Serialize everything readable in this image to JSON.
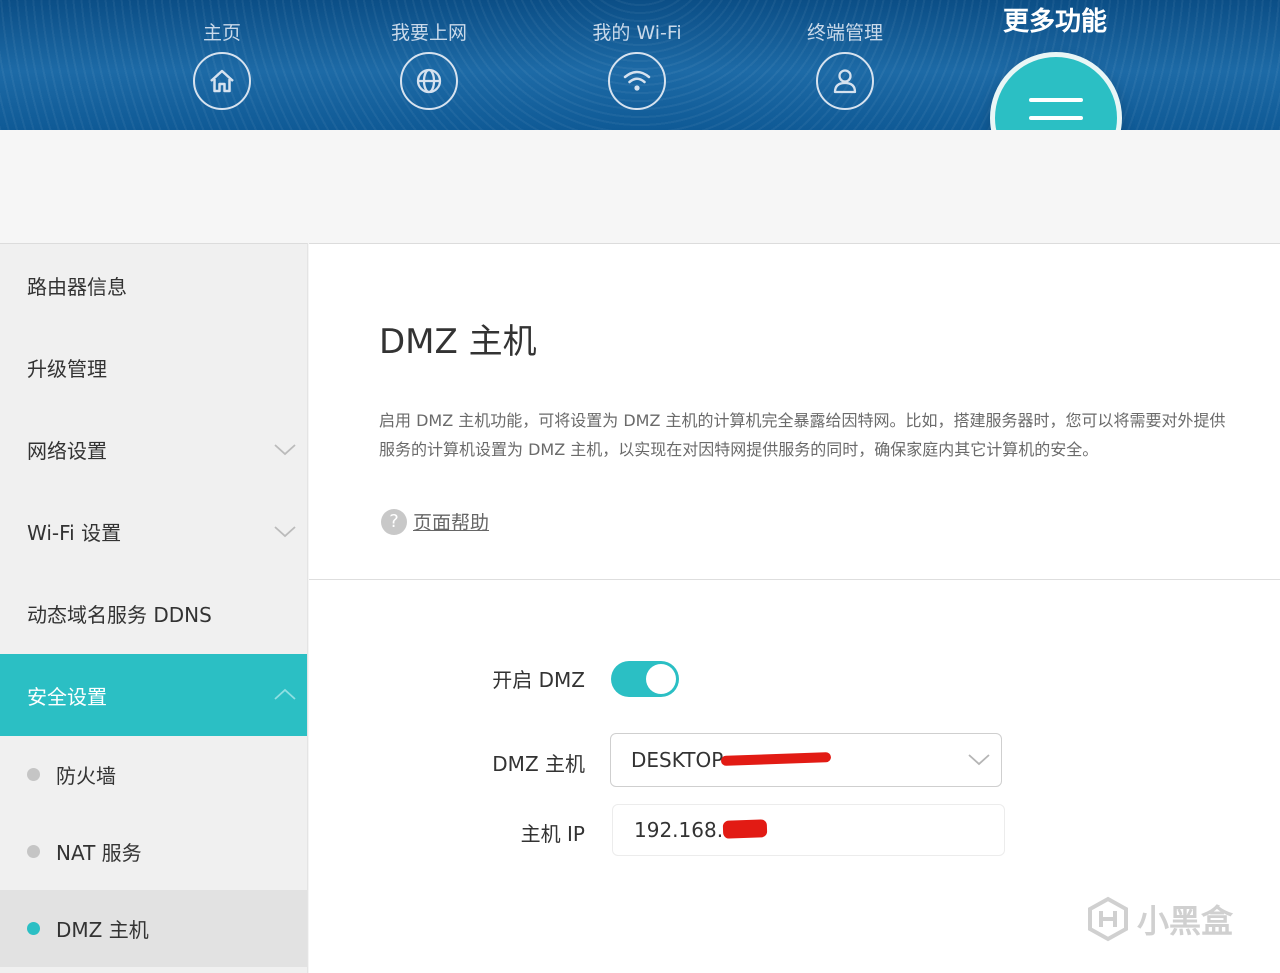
{
  "nav": {
    "items": [
      {
        "label": "主页",
        "icon": "home-icon"
      },
      {
        "label": "我要上网",
        "icon": "globe-icon"
      },
      {
        "label": "我的 Wi-Fi",
        "icon": "wifi-icon"
      },
      {
        "label": "终端管理",
        "icon": "user-icon"
      }
    ],
    "more": {
      "label": "更多功能",
      "icon": "menu-icon"
    }
  },
  "sidebar": {
    "items": [
      {
        "label": "路由器信息"
      },
      {
        "label": "升级管理"
      },
      {
        "label": "网络设置"
      },
      {
        "label": "Wi-Fi 设置"
      },
      {
        "label": "动态域名服务 DDNS"
      },
      {
        "label": "安全设置"
      }
    ],
    "subitems": [
      {
        "label": "防火墙"
      },
      {
        "label": "NAT 服务"
      },
      {
        "label": "DMZ 主机"
      }
    ]
  },
  "main": {
    "title": "DMZ 主机",
    "description_line1": "启用 DMZ 主机功能，可将设置为 DMZ 主机的计算机完全暴露给因特网。比如，搭建服务器时，您可以将需要对外提供",
    "description_line2": "服务的计算机设置为 DMZ 主机，以实现在对因特网提供服务的同时，确保家庭内其它计算机的安全。",
    "help_icon": "?",
    "help_link": "页面帮助"
  },
  "form": {
    "enable_label": "开启 DMZ",
    "enable_value": true,
    "host_label": "DMZ 主机",
    "host_value": "DESKTOP-",
    "ip_label": "主机 IP",
    "ip_value": "192.168.3"
  },
  "watermark": {
    "text": "小黑盒"
  },
  "colors": {
    "accent": "#2bbfc4",
    "topbar": "#0f5a96",
    "redaction": "#e21b14"
  }
}
